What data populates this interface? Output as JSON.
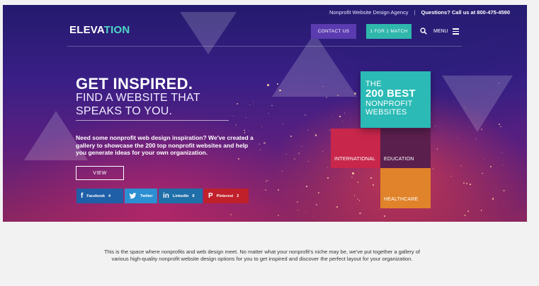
{
  "topbar": {
    "tagline": "Nonprofit Website Design Agency",
    "divider": "|",
    "phone": "Questions? Call us at 800-475-4590"
  },
  "header": {
    "logo_main": "ELEVA",
    "logo_accent": "TION",
    "contact_label": "CONTACT US",
    "match_label": "1 FOR 1 MATCH",
    "menu_label": "MENU"
  },
  "hero": {
    "headline": "GET INSPIRED.",
    "subheadline": "FIND A WEBSITE THAT SPEAKS TO YOU.",
    "intro": "Need some nonprofit web design inspiration? We've created a gallery to showcase the 200 top nonprofit websites and help you generate ideas for your own organization.",
    "view_label": "VIEW"
  },
  "share": [
    {
      "network": "Facebook",
      "count": "4",
      "icon": "f"
    },
    {
      "network": "Twitter",
      "count": "",
      "icon": "twitter-bird"
    },
    {
      "network": "LinkedIn",
      "count": "8",
      "icon": "in"
    },
    {
      "network": "Pinterest",
      "count": "2",
      "icon": "P"
    }
  ],
  "tiles": {
    "best_line1": "THE",
    "best_line2": "200 BEST",
    "best_line3": "NONPROFIT",
    "best_line4": "WEBSITES",
    "international": "INTERNATIONAL",
    "education": "EDUCATION",
    "healthcare": "HEALTHCARE"
  },
  "footer_text": "This is the space where nonprofits and web design meet. No matter what your nonprofit's niche may be, we've put together a gallery of various high-quality nonprofit website design options for you to get inspired and discover the perfect layout for your organization.",
  "colors": {
    "teal": "#2bbab5",
    "purple_button": "#5b3bb0",
    "international": "#c8264b",
    "education": "#5b1f4e",
    "healthcare": "#e0832a",
    "facebook": "#1f5fa8",
    "twitter": "#2b8fd1",
    "linkedin": "#1f6fa8",
    "pinterest": "#c0202a"
  }
}
